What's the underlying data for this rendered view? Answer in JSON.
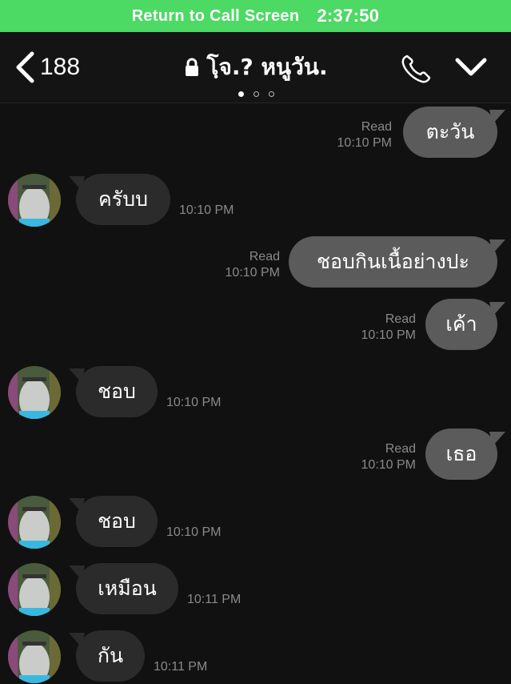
{
  "call_banner": {
    "label": "Return to Call Screen",
    "timer": "2:37:50"
  },
  "header": {
    "back_count": "188",
    "title": "โฺจ.? หนูวัน.",
    "page_dots": 3,
    "active_dot": 0
  },
  "icons": {
    "back": "chevron-left-icon",
    "lock": "lock-icon",
    "call": "phone-icon",
    "menu": "chevron-down-icon"
  },
  "colors": {
    "call_banner": "#4cd964",
    "outgoing_bubble": "#5b5b5b",
    "incoming_bubble": "#2b2b2b",
    "background": "#111111"
  },
  "messages": [
    {
      "direction": "out",
      "text": "ตะวัน",
      "read": "Read",
      "time": "10:10 PM"
    },
    {
      "direction": "in",
      "text": "ครับบ",
      "time": "10:10 PM"
    },
    {
      "direction": "out",
      "text": "ชอบกินเนื้อย่างปะ",
      "read": "Read",
      "time": "10:10 PM"
    },
    {
      "direction": "out",
      "text": "เค้า",
      "read": "Read",
      "time": "10:10 PM"
    },
    {
      "direction": "in",
      "text": "ชอบ",
      "time": "10:10 PM"
    },
    {
      "direction": "out",
      "text": "เธอ",
      "read": "Read",
      "time": "10:10 PM"
    },
    {
      "direction": "in",
      "text": "ชอบ",
      "time": "10:10 PM"
    },
    {
      "direction": "in",
      "text": "เหมือน",
      "time": "10:11 PM"
    },
    {
      "direction": "in",
      "text": "กัน",
      "time": "10:11 PM"
    }
  ]
}
